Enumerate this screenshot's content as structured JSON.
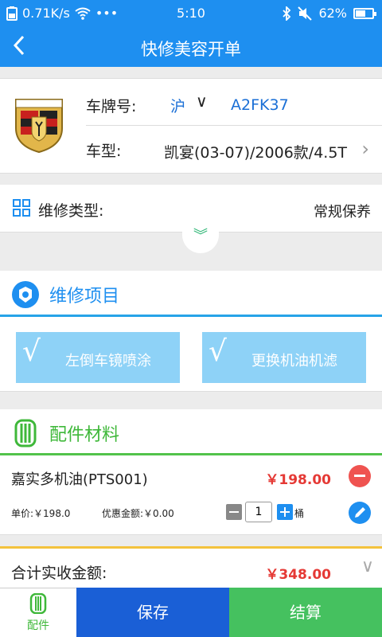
{
  "status_bar": {
    "speed": "0.71K/s",
    "dots": "•••",
    "time": "5:10",
    "battery": "62%",
    "battery_level": 0.62
  },
  "nav": {
    "title": "快修美容开单",
    "back_glyph": "‹"
  },
  "car": {
    "plate_label": "车牌号:",
    "province": "沪",
    "plate_number": "A2FK37",
    "model_label": "车型:",
    "model_value": "凯宴(03-07)/2006款/4.5T",
    "dropdown_glyph": "∨",
    "chevron_glyph": "›"
  },
  "repair_type": {
    "label": "维修类型:",
    "value": "常规保养",
    "expand_glyph": "︾"
  },
  "items_section": {
    "title": "维修项目"
  },
  "items": [
    {
      "label": "左倒车镜喷涂",
      "check": "√"
    },
    {
      "label": "更换机油机滤",
      "check": "√"
    }
  ],
  "parts_section": {
    "title": "配件材料"
  },
  "part": {
    "name": "嘉实多机油(PTS001)",
    "price": "￥198.00",
    "unit_price": "单价:￥198.0",
    "discount": "优惠金额:￥0.00",
    "quantity": "1",
    "unit": "桶"
  },
  "total": {
    "label": "合计实收金额:",
    "value": "￥348.00",
    "chevron_glyph": "∨"
  },
  "toolbar": {
    "parts_label": "配件",
    "save_label": "保存",
    "checkout_label": "结算"
  },
  "colors": {
    "primary": "#1e8ff0",
    "green": "#45c15f",
    "red": "#e53935",
    "save": "#1a5fd6"
  }
}
